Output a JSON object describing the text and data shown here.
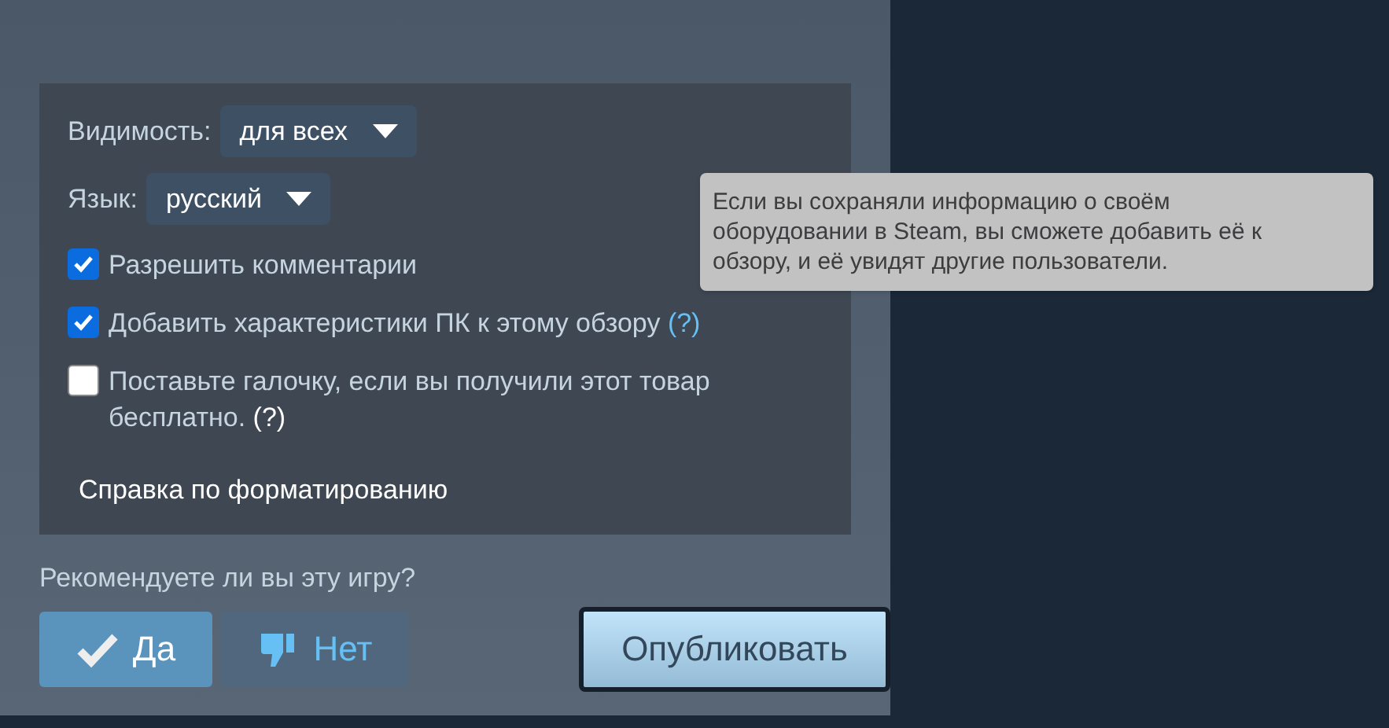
{
  "visibility": {
    "label": "Видимость:",
    "value": "для всех"
  },
  "language": {
    "label": "Язык:",
    "value": "русский"
  },
  "options": [
    {
      "label": "Разрешить комментарии",
      "checked": true
    },
    {
      "label": "Добавить характеристики ПК к этому обзору",
      "checked": true,
      "help": {
        "text": "(?)",
        "color": "#66c0f4"
      }
    },
    {
      "label": "Поставьте галочку, если вы получили этот товар бесплатно.",
      "checked": false,
      "help": {
        "text": "(?)",
        "color": "#ffffff"
      }
    }
  ],
  "formatting_help": "Справка по форматированию",
  "recommend": {
    "question": "Рекомендуете ли вы эту игру?",
    "yes": {
      "label": "Да",
      "selected": true
    },
    "no": {
      "label": "Нет",
      "selected": false
    }
  },
  "publish": "Опубликовать",
  "tooltip": "Если вы сохраняли информацию о своём оборудовании в Steam, вы сможете добавить её к обзору, и её увидят другие пользователи."
}
